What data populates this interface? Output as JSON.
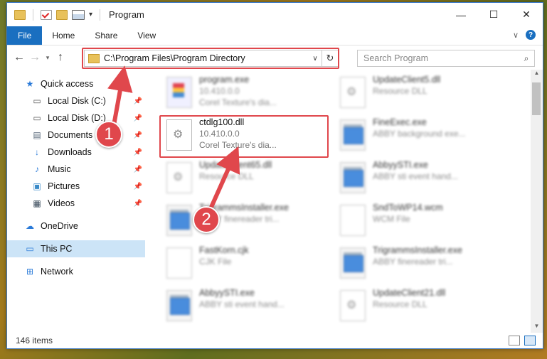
{
  "window": {
    "title": "Program",
    "controls": {
      "minimize": "—",
      "maximize": "☐",
      "close": "✕"
    }
  },
  "ribbon": {
    "tabs": [
      "File",
      "Home",
      "Share",
      "View"
    ]
  },
  "nav": {
    "address": "C:\\Program Files\\Program Directory",
    "search_placeholder": "Search Program"
  },
  "sidebar": {
    "quick_access": "Quick access",
    "items": [
      {
        "label": "Local Disk (C:)",
        "icon": "drive-icon"
      },
      {
        "label": "Local Disk (D:)",
        "icon": "drive-icon"
      },
      {
        "label": "Documents",
        "icon": "documents-icon"
      },
      {
        "label": "Downloads",
        "icon": "download-icon"
      },
      {
        "label": "Music",
        "icon": "music-icon"
      },
      {
        "label": "Pictures",
        "icon": "pictures-icon"
      },
      {
        "label": "Videos",
        "icon": "videos-icon"
      }
    ],
    "onedrive": "OneDrive",
    "this_pc": "This PC",
    "network": "Network"
  },
  "files": [
    {
      "name": "program.exe",
      "meta1": "10.410.0.0",
      "meta2": "Corel Texture's dia...",
      "icon": "exe"
    },
    {
      "name": "UpdateClient5.dll",
      "meta1": "Resource DLL",
      "meta2": "",
      "icon": "gear"
    },
    {
      "name": "ctdlg100.dll",
      "meta1": "10.410.0.0",
      "meta2": "Corel Texture's dia...",
      "icon": "gear"
    },
    {
      "name": "FineExec.exe",
      "meta1": "ABBY background exe...",
      "meta2": "",
      "icon": "app"
    },
    {
      "name": "UpdateClient65.dll",
      "meta1": "Resource DLL",
      "meta2": "",
      "icon": "gear"
    },
    {
      "name": "AbbyySTI.exe",
      "meta1": "ABBY sti event hand...",
      "meta2": "",
      "icon": "app"
    },
    {
      "name": "TrigrammsInstaller.exe",
      "meta1": "ABBY finereader tri...",
      "meta2": "",
      "icon": "app"
    },
    {
      "name": "SndToWP14.wcm",
      "meta1": "WCM File",
      "meta2": "",
      "icon": "blank"
    },
    {
      "name": "FastKorn.cjk",
      "meta1": "CJK File",
      "meta2": "",
      "icon": "blank"
    },
    {
      "name": "TrigrammsInstaller.exe",
      "meta1": "ABBY finereader tri...",
      "meta2": "",
      "icon": "app"
    },
    {
      "name": "AbbyySTI.exe",
      "meta1": "ABBY sti event hand...",
      "meta2": "",
      "icon": "app"
    },
    {
      "name": "UpdateClient21.dll",
      "meta1": "Resource DLL",
      "meta2": "",
      "icon": "gear"
    }
  ],
  "status": {
    "count": "146 items"
  },
  "callouts": [
    "1",
    "2"
  ],
  "colors": {
    "accent": "#1a6fc0",
    "highlight": "#e0474c",
    "selected": "#cce4f7"
  }
}
